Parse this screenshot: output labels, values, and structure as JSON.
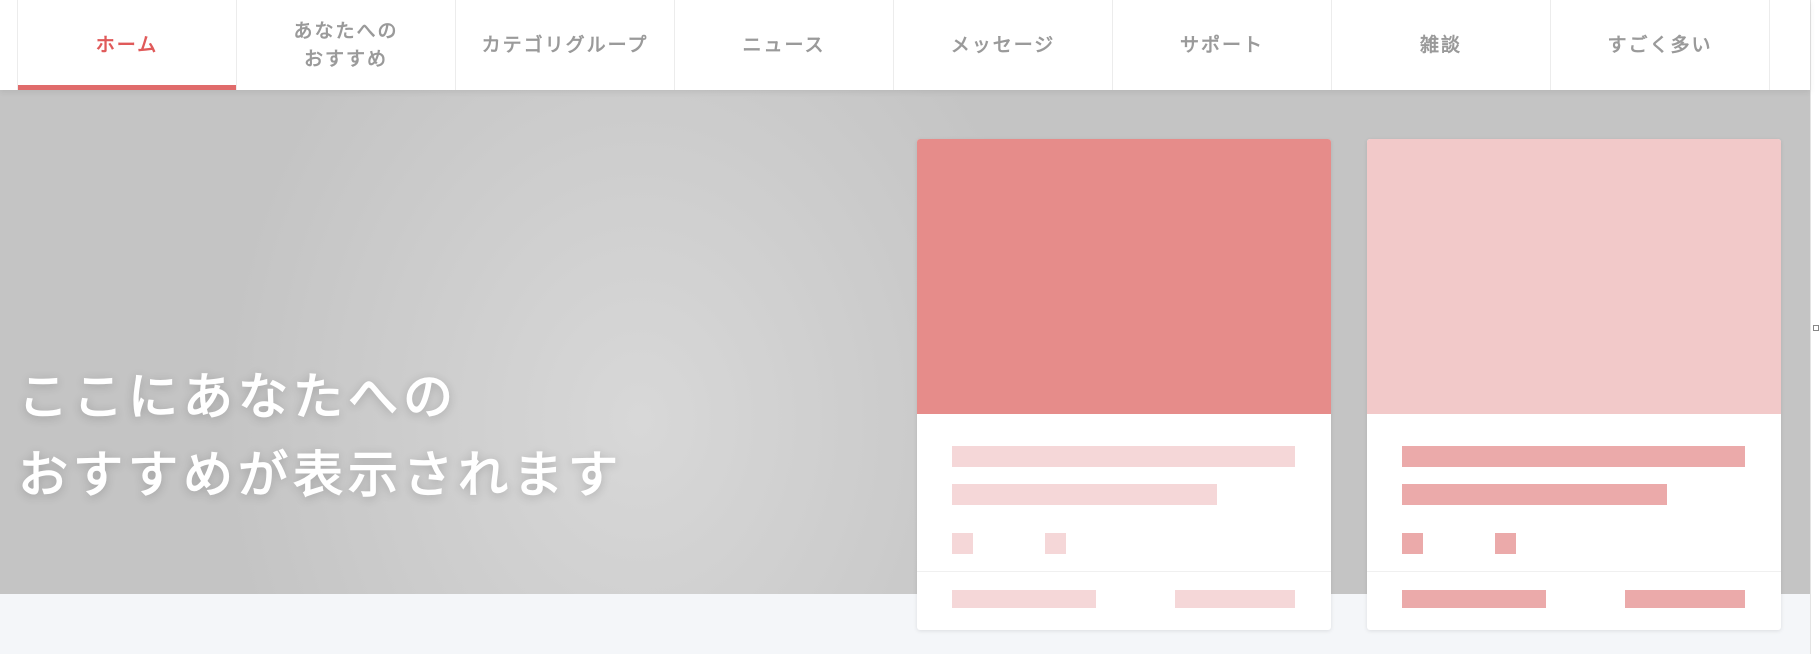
{
  "nav": {
    "tabs": [
      {
        "label": "ホーム",
        "active": true
      },
      {
        "label": "あなたへの\nおすすめ",
        "active": false
      },
      {
        "label": "カテゴリグループ",
        "active": false
      },
      {
        "label": "ニュース",
        "active": false
      },
      {
        "label": "メッセージ",
        "active": false
      },
      {
        "label": "サポート",
        "active": false
      },
      {
        "label": "雑談",
        "active": false
      },
      {
        "label": "すごく多い",
        "active": false
      }
    ]
  },
  "hero": {
    "title": "ここにあなたへの\nおすすめが表示されます"
  },
  "cards": [
    {
      "image_color": "#e68c8a",
      "placeholder_color": "#f5d7d8"
    },
    {
      "image_color": "#f2c9c9",
      "placeholder_color": "#ebaaaa"
    }
  ],
  "colors": {
    "accent": "#e05a5a",
    "tab_text": "#9a9a9a",
    "hero_bg": "#c6c6c6",
    "page_bg": "#f4f6f9"
  }
}
